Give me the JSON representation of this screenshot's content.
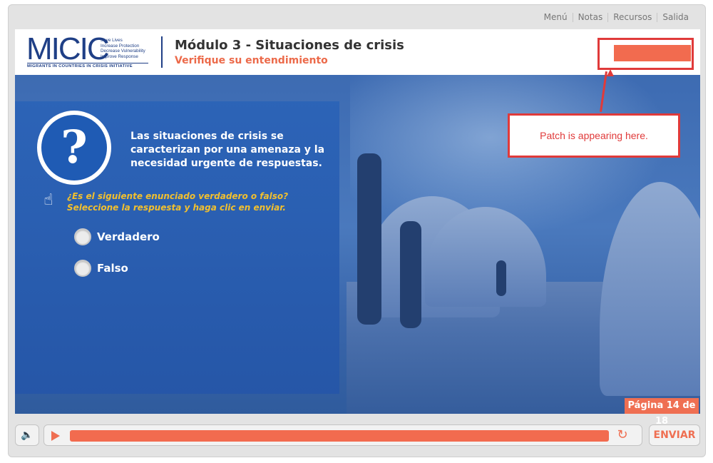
{
  "nav": {
    "items": [
      "Menú",
      "Notas",
      "Recursos",
      "Salida"
    ]
  },
  "logo": {
    "wordmark": "MICIC",
    "tagline": "Save Lives\nIncrease Protection\nDecrease Vulnerability\nImprove Response",
    "subtitle": "MIGRANTS IN COUNTRIES IN CRISIS INITIATIVE"
  },
  "header": {
    "title": "Módulo 3 - Situaciones de crisis",
    "subtitle": "Verifique su entendimiento"
  },
  "question": {
    "icon": "question-mark-icon",
    "text": "Las situaciones de crisis se caracterizan por una amenaza y la necesidad urgente de respuestas.",
    "instruction": "¿Es el siguiente enunciado verdadero o falso? Seleccione la respuesta y haga clic en enviar.",
    "options": [
      "Verdadero",
      "Falso"
    ]
  },
  "page_indicator": "Página 14 de 18",
  "annotation": {
    "callout": "Patch is appearing here."
  },
  "controls": {
    "volume_icon": "speaker-icon",
    "play_icon": "play-icon",
    "replay_icon": "replay-icon",
    "submit_label": "ENVIAR"
  },
  "colors": {
    "accent": "#ef6f52",
    "brand": "#1f3f86",
    "annotation": "#e03a3a",
    "panel": "#2556a8"
  }
}
